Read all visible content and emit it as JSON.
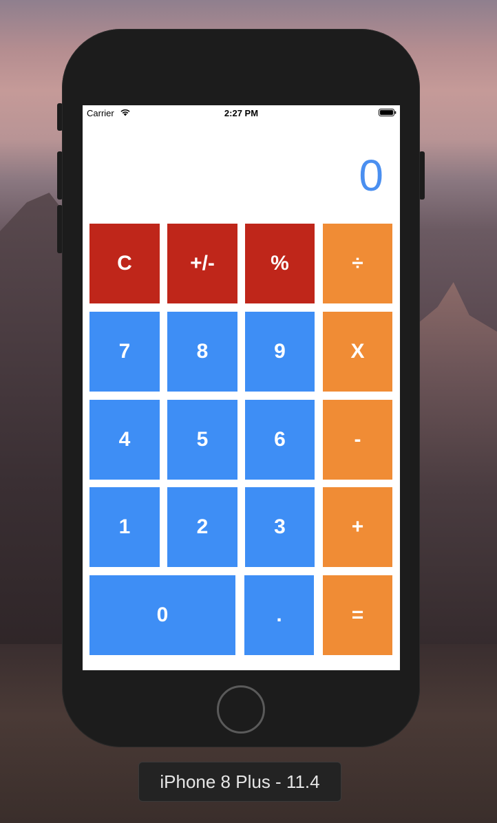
{
  "status_bar": {
    "carrier": "Carrier",
    "time": "2:27 PM",
    "wifi_icon": "wifi-icon",
    "battery_icon": "battery-icon"
  },
  "display": {
    "value": "0",
    "color": "#4a8ff0"
  },
  "keys": {
    "row1": [
      "C",
      "+/-",
      "%",
      "÷"
    ],
    "row2": [
      "7",
      "8",
      "9",
      "X"
    ],
    "row3": [
      "4",
      "5",
      "6",
      "-"
    ],
    "row4": [
      "1",
      "2",
      "3",
      "+"
    ],
    "row5": [
      "0",
      ".",
      "="
    ]
  },
  "colors": {
    "function_keys": "#bf261a",
    "number_keys": "#3e8ef5",
    "operator_keys": "#f08c35"
  },
  "simulator": {
    "device_label": "iPhone 8 Plus - 11.4"
  }
}
